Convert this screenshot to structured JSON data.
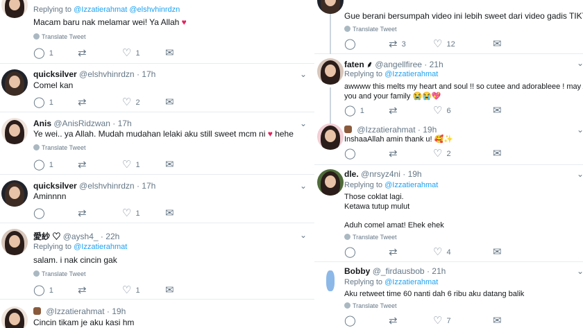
{
  "left": {
    "tweets": [
      {
        "reply_prefix": "Replying to",
        "reply_mentions": "@Izzatierahmat @elshvhinrdzn",
        "text": "Macam baru nak melamar wei! Ya Allah",
        "emoji": "♥",
        "translate": "Translate Tweet",
        "reply_count": "1",
        "retweet_count": "",
        "like_count": "1"
      },
      {
        "name": "quicksilver",
        "handle": "@elshvhinrdzn",
        "time": "17h",
        "text": "Comel kan",
        "reply_count": "1",
        "retweet_count": "",
        "like_count": "2"
      },
      {
        "name": "Anis",
        "handle": "@AnisRidzwan",
        "time": "17h",
        "text": "Ye wei.. ya Allah. Mudah mudahan lelaki aku still sweet mcm ni",
        "emoji": "♥",
        "text_tail": "hehe",
        "translate": "Translate Tweet",
        "reply_count": "1",
        "retweet_count": "",
        "like_count": "1"
      },
      {
        "name": "quicksilver",
        "handle": "@elshvhinrdzn",
        "time": "17h",
        "text": "Aminnnn",
        "reply_count": "",
        "retweet_count": "",
        "like_count": "1"
      },
      {
        "name": "愛紗 ♡",
        "handle": "@aysh4_",
        "time": "22h",
        "reply_prefix": "Replying to",
        "reply_mentions": "@Izzatierahmat",
        "text": "salam. i nak cincin gak",
        "translate": "Translate Tweet",
        "reply_count": "1",
        "retweet_count": "",
        "like_count": "1"
      },
      {
        "name": "",
        "handle": "@Izzatierahmat",
        "time": "19h",
        "text": "Cincin tikam je aku kasi hm"
      }
    ]
  },
  "right": {
    "tweets": [
      {
        "text": "Gue berani bersumpah video ini lebih sweet dari video gadis TIKTOK",
        "emoji": "😥",
        "translate": "Translate Tweet",
        "reply_count": "",
        "retweet_count": "3",
        "like_count": "12"
      },
      {
        "name": "faten ⸙",
        "handle": "@angellfiree",
        "time": "21h",
        "reply_prefix": "Replying to",
        "reply_mentions": "@Izzatierahmat",
        "text_line1": "awwww this melts my heart and soul !! so cutee and adorableee ! may Allah bless",
        "text_line2": "you and your family",
        "emoji": "😭😭💖",
        "reply_count": "1",
        "retweet_count": "",
        "like_count": "6"
      },
      {
        "name": "",
        "handle": "@Izzatierahmat",
        "time": "19h",
        "text": "InshaaAllah amin thank u!",
        "emoji": "🥰✨",
        "reply_count": "",
        "retweet_count": "",
        "like_count": "2"
      },
      {
        "name": "dle.",
        "handle": "@nrsyz4ni",
        "time": "19h",
        "reply_prefix": "Replying to",
        "reply_mentions": "@Izzatierahmat",
        "text_line1": "Those coklat lagi.",
        "text_line2": "Ketawa tutup mulut",
        "text_line3": "Aduh comel amat! Ehek ehek",
        "translate": "Translate Tweet",
        "reply_count": "",
        "retweet_count": "",
        "like_count": "4"
      },
      {
        "name": "Bobby",
        "handle": "@_firdausbob",
        "time": "21h",
        "reply_prefix": "Replying to",
        "reply_mentions": "@Izzatierahmat",
        "text": "Aku retweet time 60 nanti dah 6 ribu aku datang balik",
        "translate": "Translate Tweet",
        "reply_count": "",
        "retweet_count": "",
        "like_count": "7"
      }
    ]
  },
  "icons": {
    "reply": "reply-icon",
    "retweet": "retweet-icon",
    "like": "heart-icon",
    "dm": "envelope-icon",
    "caret": "chevron-down-icon",
    "translate": "globe-icon"
  },
  "colors": {
    "link": "#1da1f2",
    "muted": "#657786",
    "divider": "#e6ecf0",
    "heart": "#e0245e"
  }
}
